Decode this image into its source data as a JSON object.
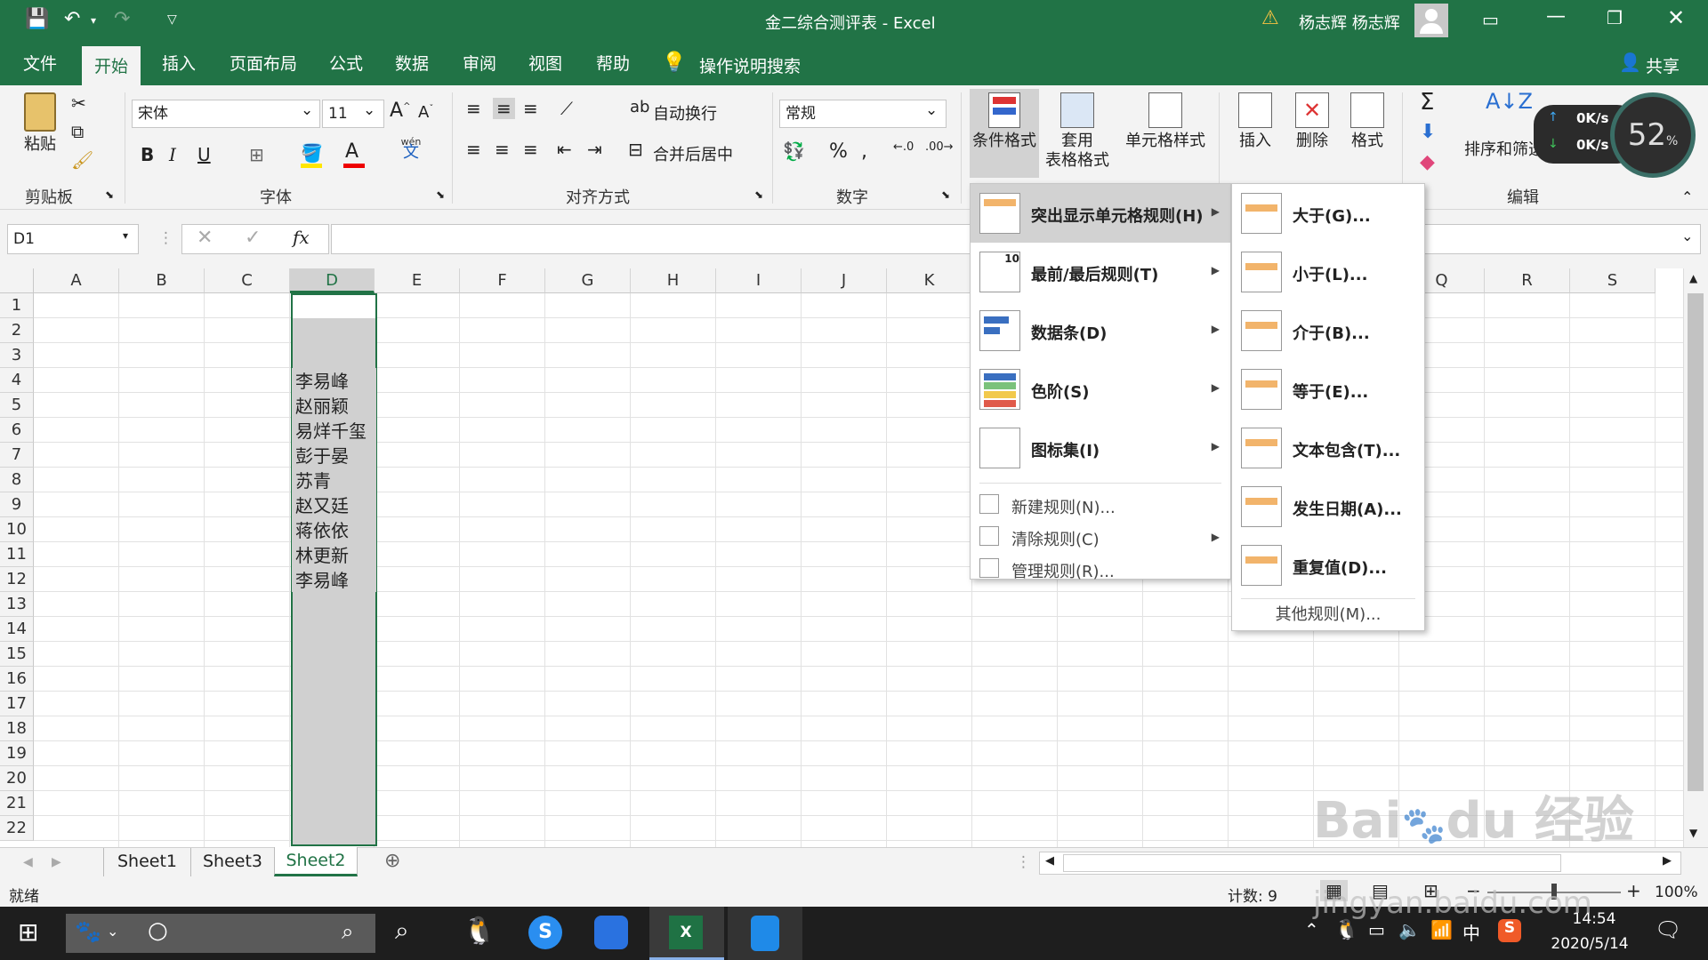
{
  "window": {
    "title": "金二综合测评表  -  Excel",
    "user": "杨志辉 杨志辉"
  },
  "tabs": [
    "文件",
    "开始",
    "插入",
    "页面布局",
    "公式",
    "数据",
    "审阅",
    "视图",
    "帮助"
  ],
  "search_label": "操作说明搜索",
  "share_label": "共享",
  "ribbon": {
    "paste": "粘贴",
    "clipboard": "剪贴板",
    "font_name": "宋体",
    "font_size": "11",
    "font": "字体",
    "wrap_text": "自动换行",
    "merge_center": "合并后居中",
    "alignment": "对齐方式",
    "number_format": "常规",
    "number": "数字",
    "cond_format": "条件格式",
    "table_format_1": "套用",
    "table_format_2": "表格格式",
    "cell_style": "单元格样式",
    "insert": "插入",
    "delete": "删除",
    "format": "格式",
    "sort_filter": "排序和筛选",
    "editing": "编辑",
    "wen": "wén",
    "wen_char": "文",
    "percent": "%"
  },
  "net_widget": {
    "up": "0K/s",
    "down": "0K/s",
    "percent": "52"
  },
  "namebox": "D1",
  "columns": [
    "A",
    "B",
    "C",
    "D",
    "E",
    "F",
    "G",
    "H",
    "I",
    "J",
    "K",
    "",
    "",
    "",
    "",
    "",
    "Q",
    "R",
    "S"
  ],
  "rows": [
    "1",
    "2",
    "3",
    "4",
    "5",
    "6",
    "7",
    "8",
    "9",
    "10",
    "11",
    "12",
    "13",
    "14",
    "15",
    "16",
    "17",
    "18",
    "19",
    "20",
    "21",
    "22"
  ],
  "cells_D": [
    "",
    "",
    "",
    "李易峰",
    "赵丽颖",
    "易烊千玺",
    "彭于晏",
    "苏青",
    "赵又廷",
    "蒋依依",
    "林更新",
    "李易峰"
  ],
  "sheets": [
    "Sheet1",
    "Sheet3",
    "Sheet2"
  ],
  "active_sheet": "Sheet2",
  "status": {
    "ready": "就绪",
    "count": "计数: 9",
    "zoom": "100%"
  },
  "cf_menu": {
    "items": [
      "突出显示单元格规则(H)",
      "最前/最后规则(T)",
      "数据条(D)",
      "色阶(S)",
      "图标集(I)"
    ],
    "small": [
      "新建规则(N)...",
      "清除规则(C)",
      "管理规则(R)..."
    ]
  },
  "sub_menu": {
    "items": [
      "大于(G)...",
      "小于(L)...",
      "介于(B)...",
      "等于(E)...",
      "文本包含(T)...",
      "发生日期(A)...",
      "重复值(D)..."
    ],
    "more": "其他规则(M)..."
  },
  "taskbar": {
    "time": "14:54",
    "date": "2020/5/14",
    "ime": "中"
  },
  "watermark": {
    "logo": "Bai du 经验",
    "url": "jingyan.baidu.com"
  },
  "colors": {
    "excel_green": "#217346",
    "ribbon_bg": "#f3f3f3",
    "selection_gray": "#d0d0d0"
  }
}
